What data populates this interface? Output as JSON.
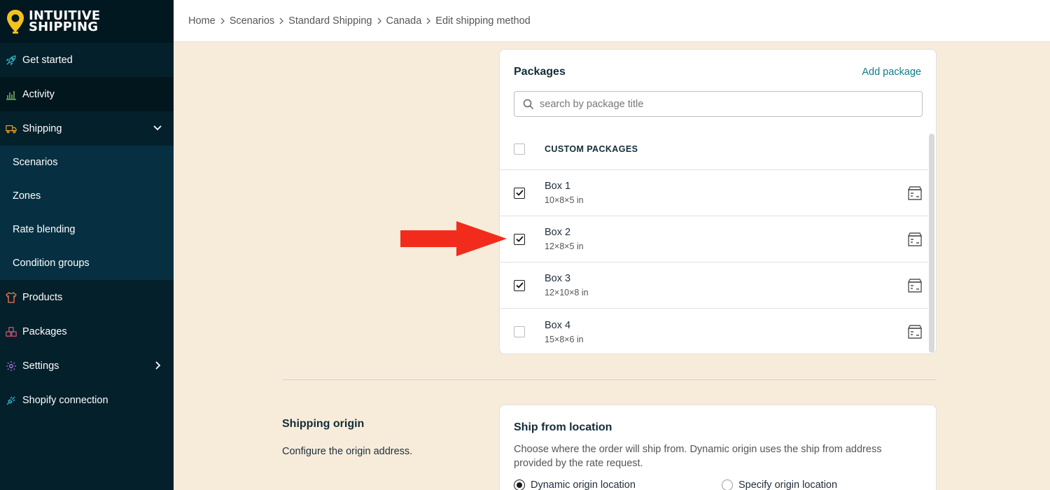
{
  "brand": {
    "line1": "INTUITIVE",
    "line2": "SHIPPING",
    "pin_color": "#f5c21b"
  },
  "sidebar": {
    "items": [
      {
        "label": "Get started",
        "icon": "rocket-icon"
      },
      {
        "label": "Activity",
        "icon": "bar-chart-icon"
      },
      {
        "label": "Shipping",
        "icon": "truck-icon"
      },
      {
        "label": "Products",
        "icon": "shirt-icon"
      },
      {
        "label": "Packages",
        "icon": "boxes-icon"
      },
      {
        "label": "Settings",
        "icon": "gear-icon"
      },
      {
        "label": "Shopify connection",
        "icon": "plug-icon"
      }
    ],
    "shipping_sub": [
      "Scenarios",
      "Zones",
      "Rate blending",
      "Condition groups"
    ]
  },
  "breadcrumb": [
    "Home",
    "Scenarios",
    "Standard Shipping",
    "Canada",
    "Edit shipping method"
  ],
  "packages": {
    "title": "Packages",
    "add_label": "Add package",
    "search_placeholder": "search by package title",
    "column_header": "CUSTOM PACKAGES",
    "rows": [
      {
        "name": "Box 1",
        "dims": "10×8×5 in",
        "checked": true
      },
      {
        "name": "Box 2",
        "dims": "12×8×5 in",
        "checked": true
      },
      {
        "name": "Box 3",
        "dims": "12×10×8 in",
        "checked": true
      },
      {
        "name": "Box 4",
        "dims": "15×8×6 in",
        "checked": false
      }
    ]
  },
  "shipping_origin": {
    "title": "Shipping origin",
    "description": "Configure the origin address.",
    "card_title": "Ship from location",
    "card_description": "Choose where the order will ship from. Dynamic origin uses the ship from address provided by the rate request.",
    "option_dynamic": "Dynamic origin location",
    "option_specify": "Specify origin location",
    "selected": "dynamic"
  },
  "colors": {
    "sidebar": "#04202b",
    "accent": "#0e7c86",
    "background": "#f7ecda",
    "annotation_arrow": "#f22c1d"
  }
}
